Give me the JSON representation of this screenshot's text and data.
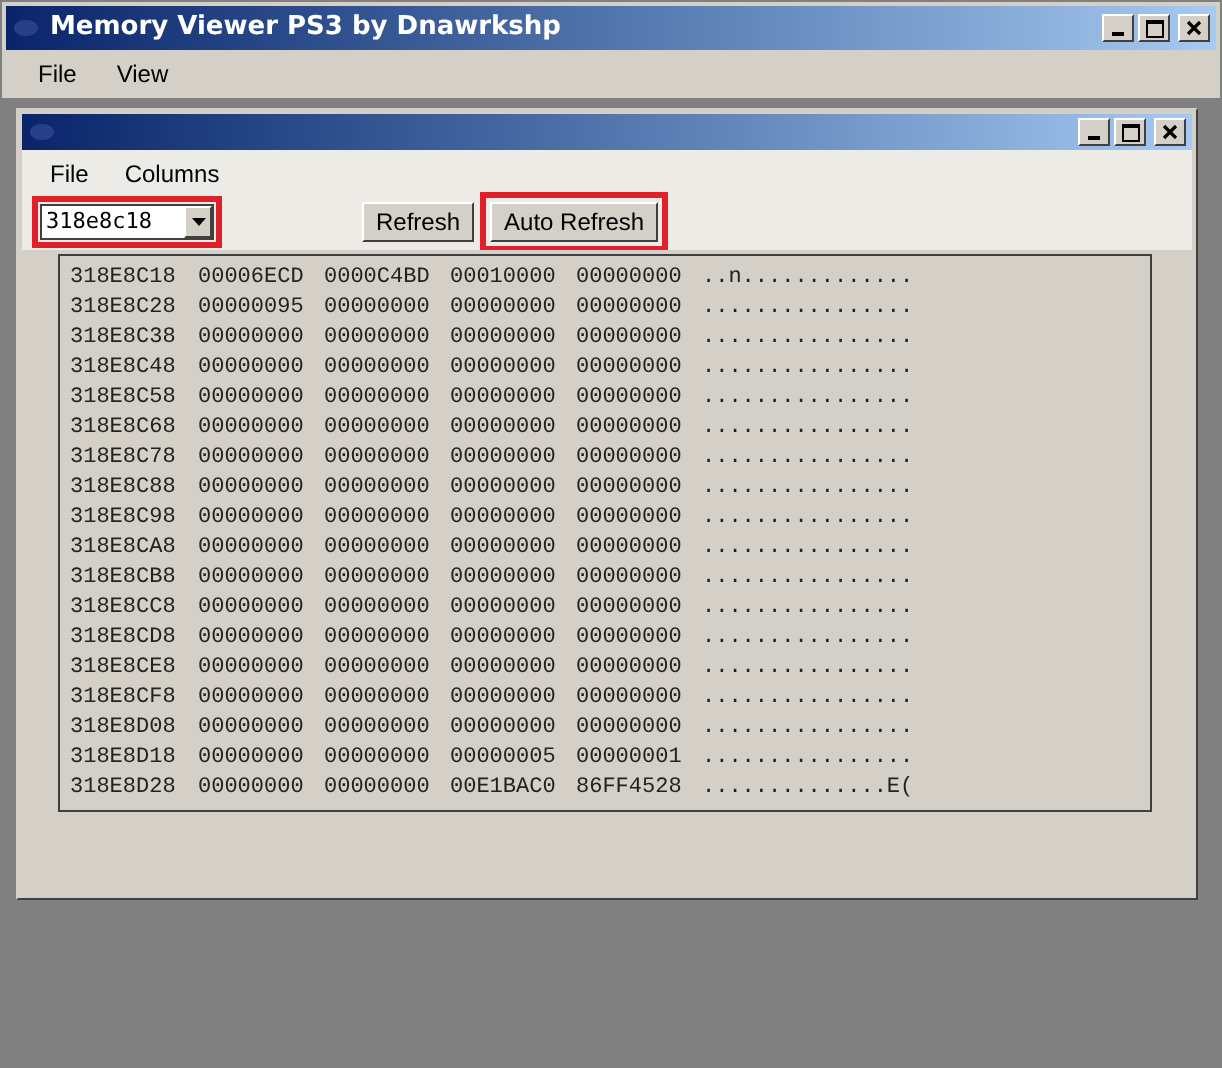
{
  "window": {
    "title": "Memory Viewer PS3 by Dnawrkshp"
  },
  "menu": [
    "File",
    "View"
  ],
  "child_window": {
    "menu": [
      "File",
      "Columns"
    ],
    "address_field": {
      "value": "318e8c18"
    },
    "buttons": [
      "Refresh",
      "Auto Refresh"
    ],
    "rows": [
      {
        "address": "318E8C18",
        "words": [
          "00006ECD",
          "0000C4BD",
          "00010000",
          "00000000"
        ],
        "ascii": "..n............."
      },
      {
        "address": "318E8C28",
        "words": [
          "00000095",
          "00000000",
          "00000000",
          "00000000"
        ],
        "ascii": "................"
      },
      {
        "address": "318E8C38",
        "words": [
          "00000000",
          "00000000",
          "00000000",
          "00000000"
        ],
        "ascii": "................"
      },
      {
        "address": "318E8C48",
        "words": [
          "00000000",
          "00000000",
          "00000000",
          "00000000"
        ],
        "ascii": "................"
      },
      {
        "address": "318E8C58",
        "words": [
          "00000000",
          "00000000",
          "00000000",
          "00000000"
        ],
        "ascii": "................"
      },
      {
        "address": "318E8C68",
        "words": [
          "00000000",
          "00000000",
          "00000000",
          "00000000"
        ],
        "ascii": "................"
      },
      {
        "address": "318E8C78",
        "words": [
          "00000000",
          "00000000",
          "00000000",
          "00000000"
        ],
        "ascii": "................"
      },
      {
        "address": "318E8C88",
        "words": [
          "00000000",
          "00000000",
          "00000000",
          "00000000"
        ],
        "ascii": "................"
      },
      {
        "address": "318E8C98",
        "words": [
          "00000000",
          "00000000",
          "00000000",
          "00000000"
        ],
        "ascii": "................"
      },
      {
        "address": "318E8CA8",
        "words": [
          "00000000",
          "00000000",
          "00000000",
          "00000000"
        ],
        "ascii": "................"
      },
      {
        "address": "318E8CB8",
        "words": [
          "00000000",
          "00000000",
          "00000000",
          "00000000"
        ],
        "ascii": "................"
      },
      {
        "address": "318E8CC8",
        "words": [
          "00000000",
          "00000000",
          "00000000",
          "00000000"
        ],
        "ascii": "................"
      },
      {
        "address": "318E8CD8",
        "words": [
          "00000000",
          "00000000",
          "00000000",
          "00000000"
        ],
        "ascii": "................"
      },
      {
        "address": "318E8CE8",
        "words": [
          "00000000",
          "00000000",
          "00000000",
          "00000000"
        ],
        "ascii": "................"
      },
      {
        "address": "318E8CF8",
        "words": [
          "00000000",
          "00000000",
          "00000000",
          "00000000"
        ],
        "ascii": "................"
      },
      {
        "address": "318E8D08",
        "words": [
          "00000000",
          "00000000",
          "00000000",
          "00000000"
        ],
        "ascii": "................"
      },
      {
        "address": "318E8D18",
        "words": [
          "00000000",
          "00000000",
          "00000005",
          "00000001"
        ],
        "ascii": "................"
      },
      {
        "address": "318E8D28",
        "words": [
          "00000000",
          "00000000",
          "00E1BAC0",
          "86FF4528"
        ],
        "ascii": "..............E("
      }
    ]
  }
}
